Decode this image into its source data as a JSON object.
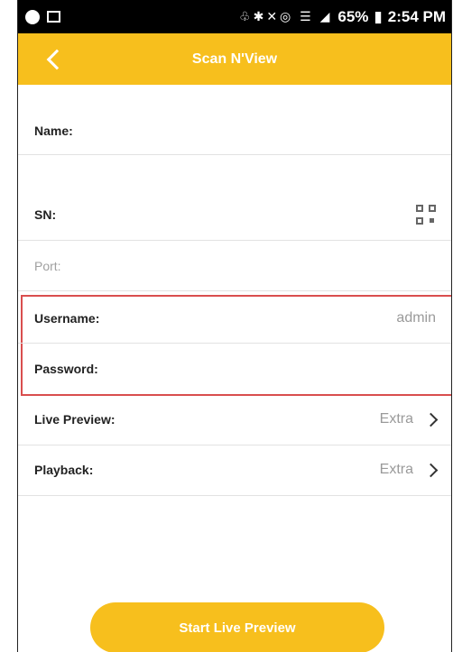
{
  "status_bar": {
    "icons_left": [
      "spotify-icon",
      "image-icon"
    ],
    "battery": "65%",
    "time": "2:54 PM"
  },
  "header": {
    "title": "Scan N'View"
  },
  "form": {
    "name_label": "Name:",
    "sn_label": "SN:",
    "port_label": "Port:",
    "username_label": "Username:",
    "username_value": "admin",
    "password_label": "Password:",
    "live_preview_label": "Live Preview:",
    "live_preview_value": "Extra",
    "playback_label": "Playback:",
    "playback_value": "Extra"
  },
  "actions": {
    "start_live_preview": "Start Live Preview"
  },
  "colors": {
    "accent": "#f7bf1d",
    "highlight_border": "#d94e4e"
  }
}
